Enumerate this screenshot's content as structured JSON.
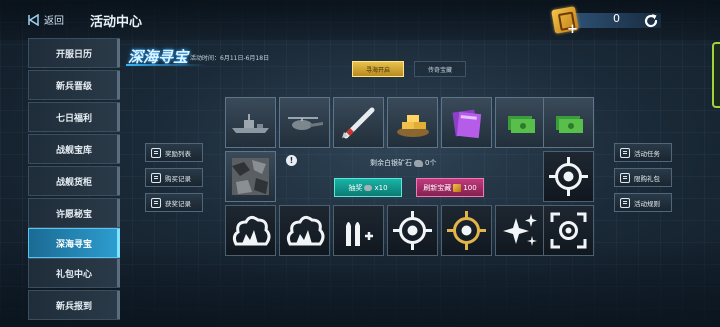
{
  "topbar": {
    "back_label": "返回",
    "title": "活动中心",
    "currency_value": "0",
    "currency_icon": "treasure-card-icon",
    "refresh_icon": "refresh-icon"
  },
  "sidebar": {
    "items": [
      {
        "label": "开服日历",
        "active": false
      },
      {
        "label": "新兵晋级",
        "active": false
      },
      {
        "label": "七日福利",
        "active": false
      },
      {
        "label": "战舰宝库",
        "active": false
      },
      {
        "label": "战舰货柜",
        "active": false
      },
      {
        "label": "许愿秘宝",
        "active": false
      },
      {
        "label": "深海寻宝",
        "active": true
      },
      {
        "label": "礼包中心",
        "active": false
      },
      {
        "label": "新兵报到",
        "active": false
      }
    ]
  },
  "event": {
    "title": "深海寻宝",
    "time": "活动时间：6月11日-6月18日",
    "tabs": [
      {
        "label": "寻海开启",
        "active": true
      },
      {
        "label": "传奇宝藏",
        "active": false
      }
    ]
  },
  "grid": {
    "top_row": [
      "warship-icon",
      "helicopter-icon",
      "missile-icon",
      "gold-bars-icon",
      "purple-books-icon",
      "green-cash-icon",
      "green-cash-icon"
    ],
    "middle_left": "camouflage-paint-icon",
    "middle_right": "target-reticle-icon",
    "bottom_row": [
      "explosion-icon",
      "explosion-icon",
      "ammo-plus-icon",
      "target-reticle-icon",
      "gold-target-icon",
      "sparkle-icon",
      "lock-on-icon"
    ]
  },
  "center": {
    "remaining_label": "剩余白银矿石",
    "remaining_value": "0个",
    "draw_label": "抽奖",
    "draw_cost": "x10",
    "refresh_label": "刷新宝藏",
    "refresh_cost": "100"
  },
  "left_buttons": [
    {
      "label": "奖励列表",
      "icon": "reward-list-icon"
    },
    {
      "label": "购买记录",
      "icon": "purchase-record-icon"
    },
    {
      "label": "获奖记录",
      "icon": "win-record-icon"
    }
  ],
  "right_buttons": [
    {
      "label": "活动任务",
      "icon": "task-icon"
    },
    {
      "label": "限购礼包",
      "icon": "gift-icon"
    },
    {
      "label": "活动规则",
      "icon": "rules-icon"
    }
  ]
}
